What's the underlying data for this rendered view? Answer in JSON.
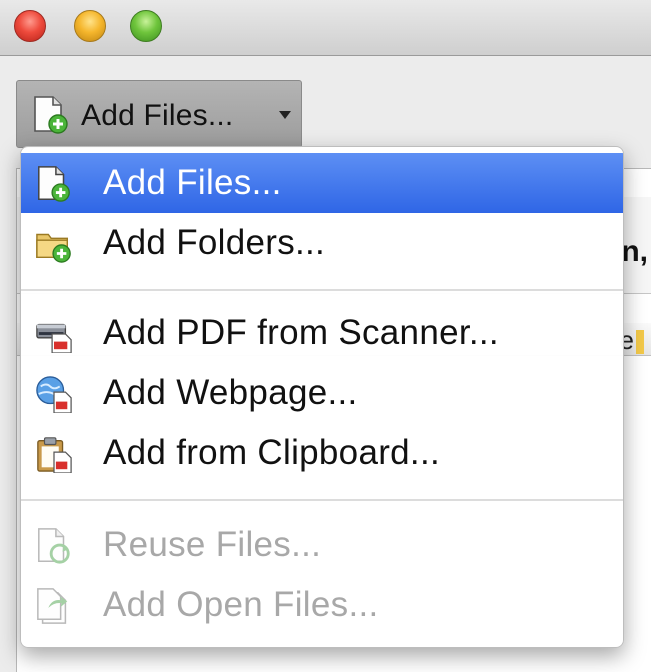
{
  "toolbar": {
    "add_files_button": {
      "label": "Add Files...",
      "icon": "add-file-icon"
    }
  },
  "background": {
    "header_text": "n,",
    "column_text": "e"
  },
  "menu": {
    "items": [
      {
        "label": "Add Files...",
        "icon": "add-file-icon",
        "state": "selected"
      },
      {
        "label": "Add Folders...",
        "icon": "add-folder-icon",
        "state": "enabled"
      },
      {
        "label": "Add PDF from Scanner...",
        "icon": "scanner-icon",
        "state": "enabled"
      },
      {
        "label": "Add Webpage...",
        "icon": "webpage-globe-icon",
        "state": "enabled"
      },
      {
        "label": "Add from Clipboard...",
        "icon": "clipboard-icon",
        "state": "enabled"
      },
      {
        "label": "Reuse Files...",
        "icon": "reuse-files-icon",
        "state": "disabled"
      },
      {
        "label": "Add Open Files...",
        "icon": "open-files-icon",
        "state": "disabled"
      }
    ]
  },
  "colors": {
    "selection": "#3a72ea",
    "disabled_text": "#a8a8a8",
    "add_badge_green": "#4bb53a",
    "pdf_badge_red": "#d8302c"
  }
}
